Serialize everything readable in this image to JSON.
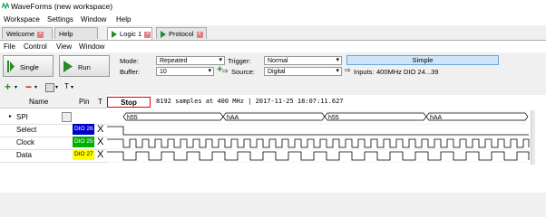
{
  "window": {
    "title": "WaveForms  (new workspace)"
  },
  "menubar": [
    "Workspace",
    "Settings",
    "Window",
    "Help"
  ],
  "tabs": [
    {
      "label": "Welcome",
      "closable": true
    },
    {
      "label": "Help",
      "closable": false
    },
    {
      "label": "Logic 1",
      "closable": true,
      "active": true
    },
    {
      "label": "Protocol",
      "closable": true
    }
  ],
  "submenu": [
    "File",
    "Control",
    "View",
    "Window"
  ],
  "toolbar": {
    "single_label": "Single",
    "run_label": "Run",
    "mode_label": "Mode:",
    "mode_value": "Repeated",
    "buffer_label": "Buffer:",
    "buffer_value": "10",
    "trigger_label": "Trigger:",
    "trigger_value": "Normal",
    "source_label": "Source:",
    "source_value": "Digital",
    "simple_label": "Simple",
    "inputs_label": "Inputs:",
    "inputs_value": "400MHz DIO 24...39"
  },
  "tools": {
    "add": "+",
    "remove": "−",
    "t_label": "T"
  },
  "grid": {
    "col_name": "Name",
    "col_pin": "Pin",
    "col_t": "T",
    "status": "Stop",
    "info": "8192 samples at 400 MHz | 2017-11-25 18:07:11.627",
    "rows": [
      {
        "name": "SPI",
        "pin": ""
      },
      {
        "name": "Select",
        "pin": "DIO 26",
        "pin_color": "#0000cc",
        "text_color": "#ffffff",
        "trigger": "X"
      },
      {
        "name": "Clock",
        "pin": "DIO 25",
        "pin_color": "#00b000",
        "text_color": "#ffffff",
        "trigger": "X"
      },
      {
        "name": "Data",
        "pin": "DIO 27",
        "pin_color": "#ffff00",
        "text_color": "#000000",
        "trigger": "X"
      }
    ],
    "spi_bytes": [
      "h55",
      "hAA",
      "h55",
      "hAA"
    ]
  }
}
